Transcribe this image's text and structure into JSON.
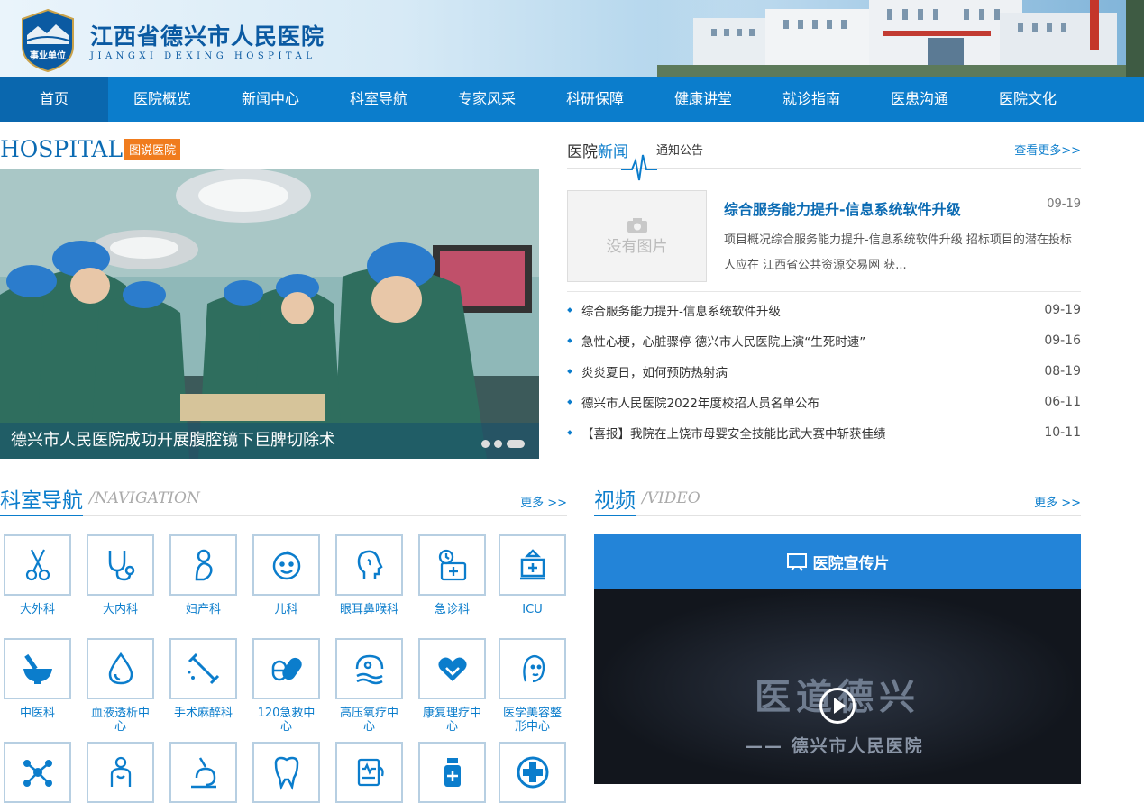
{
  "header": {
    "logo_badge": "事业单位",
    "logo_cn": "江西省德兴市人民医院",
    "logo_en": "JIANGXI DEXING HOSPITAL"
  },
  "nav": [
    "首页",
    "医院概览",
    "新闻中心",
    "科室导航",
    "专家风采",
    "科研保障",
    "健康讲堂",
    "就诊指南",
    "医患沟通",
    "医院文化"
  ],
  "gallery": {
    "title_en": "HOSPITAL",
    "tag": "图说医院",
    "caption": "德兴市人民医院成功开展腹腔镜下巨脾切除术"
  },
  "news": {
    "tab_active_prefix": "医院",
    "tab_active_hl": "新闻",
    "tab_other": "通知公告",
    "more": "查看更多>>",
    "no_image": "没有图片",
    "featured": {
      "title": "综合服务能力提升-信息系统软件升级",
      "date": "09-19",
      "desc": "项目概况综合服务能力提升-信息系统软件升级 招标项目的潜在投标人应在 江西省公共资源交易网 获..."
    },
    "items": [
      {
        "title": "综合服务能力提升-信息系统软件升级",
        "date": "09-19"
      },
      {
        "title": "急性心梗，心脏骤停 德兴市人民医院上演“生死时速”",
        "date": "09-16"
      },
      {
        "title": "炎炎夏日，如何预防热射病",
        "date": "08-19"
      },
      {
        "title": "德兴市人民医院2022年度校招人员名单公布",
        "date": "06-11"
      },
      {
        "title": "【喜报】我院在上饶市母婴安全技能比武大赛中斩获佳绩",
        "date": "10-11"
      }
    ]
  },
  "departments": {
    "title_cn": "科室导航",
    "title_en": "/NAVIGATION",
    "more": "更多 >>",
    "row1": [
      "大外科",
      "大内科",
      "妇产科",
      "儿科",
      "眼耳鼻喉科",
      "急诊科",
      "ICU"
    ],
    "row2": [
      "中医科",
      "血液透析中心",
      "手术麻醉科",
      "120急救中心",
      "高压氧疗中心",
      "康复理疗中心",
      "医学美容整形中心"
    ]
  },
  "video": {
    "title_cn": "视频",
    "title_en": "/VIDEO",
    "more": "更多 >>",
    "banner": "医院宣传片",
    "overlay_title": "医道德兴",
    "overlay_sub": "—— 德兴市人民医院"
  },
  "colors": {
    "primary": "#0b7dcc",
    "nav_active": "#0a67ae",
    "tag": "#f07c1e",
    "video_banner": "#2384d8"
  }
}
